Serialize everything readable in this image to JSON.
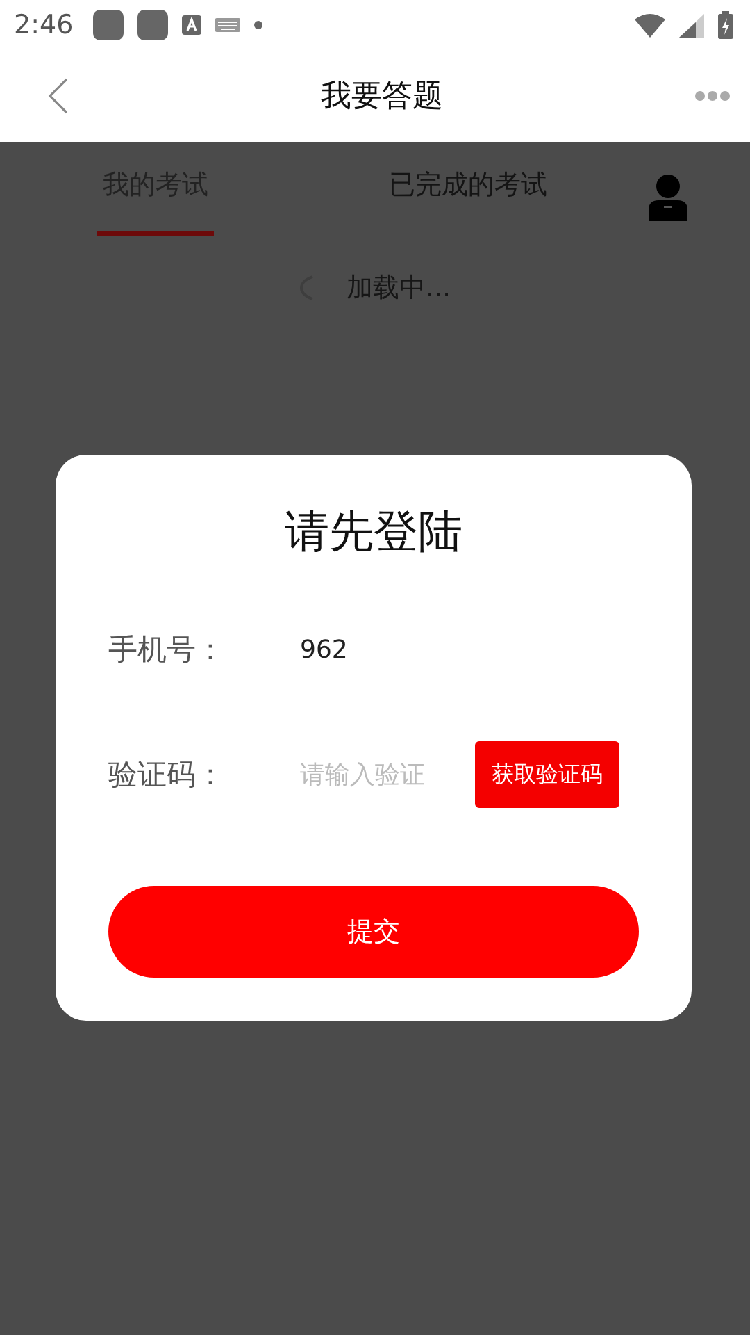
{
  "status_bar": {
    "time": "2:46"
  },
  "nav": {
    "title": "我要答题"
  },
  "tabs": [
    {
      "label": "我的考试",
      "selected": true
    },
    {
      "label": "已完成的考试",
      "selected": false
    }
  ],
  "loading": {
    "text": "加载中..."
  },
  "dialog": {
    "title": "请先登陆",
    "fields": [
      {
        "kind": "phone",
        "label": "手机号：",
        "value": "962"
      },
      {
        "kind": "code",
        "label": "验证码：",
        "placeholder": "请输入验证",
        "button": "获取验证码"
      }
    ],
    "submit": "提交"
  }
}
